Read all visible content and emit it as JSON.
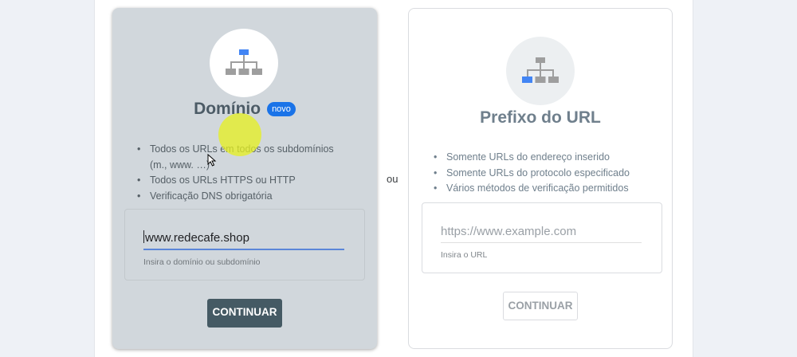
{
  "divider_text": "ou",
  "colors": {
    "accent": "#1a73e8",
    "domain_card_bg": "#d1d7dc",
    "continue_button_bg": "#455a64"
  },
  "domain": {
    "title": "Domínio",
    "badge": "novo",
    "icon": "sitemap-icon",
    "features": [
      "Todos os URLs em todos os subdomínios (m., www. …)",
      "Todos os URLs HTTPS ou HTTP",
      "Verificação DNS obrigatória"
    ],
    "input": {
      "value": "www.redecafe.shop",
      "helper": "Insira o domínio ou subdomínio"
    },
    "button": "CONTINUAR"
  },
  "url_prefix": {
    "title": "Prefixo do URL",
    "icon": "sitemap-icon",
    "features": [
      "Somente URLs do endereço inserido",
      "Somente URLs do protocolo especificado",
      "Vários métodos de verificação permitidos"
    ],
    "input": {
      "placeholder": "https://www.example.com",
      "helper": "Insira o URL"
    },
    "button": "CONTINUAR"
  }
}
